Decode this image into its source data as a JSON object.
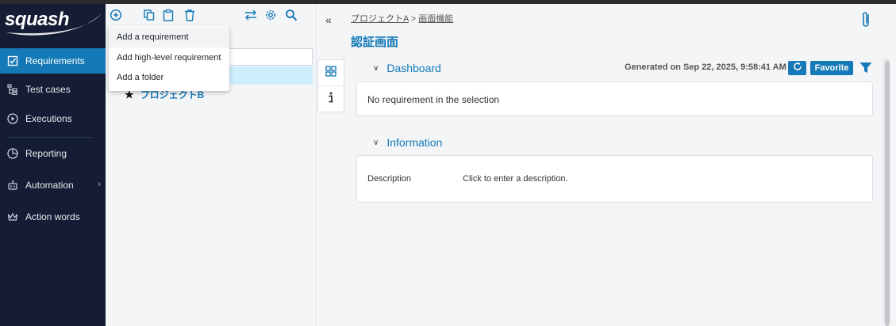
{
  "app": {
    "logo_text": "squash"
  },
  "sidebar": {
    "items": [
      {
        "label": "Requirements",
        "icon": "checkbox-icon",
        "active": true
      },
      {
        "label": "Test cases",
        "icon": "tree-icon"
      },
      {
        "label": "Executions",
        "icon": "play-circle-icon"
      },
      {
        "label": "Reporting",
        "icon": "pie-chart-icon"
      },
      {
        "label": "Automation",
        "icon": "robot-icon"
      },
      {
        "label": "Action words",
        "icon": "crown-icon"
      }
    ]
  },
  "tree": {
    "toolbar_icons": [
      "add-circle-icon",
      "copy-icon",
      "paste-icon",
      "trash-icon",
      "transfer-icon",
      "settings-icon",
      "search-icon"
    ],
    "rows": [
      {
        "label": "プロジェクトB",
        "favorite_icon": "star-icon"
      }
    ]
  },
  "add_menu": {
    "items": [
      "Add a requirement",
      "Add high-level requirement",
      "Add a folder"
    ]
  },
  "main": {
    "breadcrumb": {
      "project": "プロジェクトA",
      "separator": " > ",
      "folder": "画面機能"
    },
    "title": "認証画面",
    "dashboard": {
      "title": "Dashboard",
      "generated": "Generated on Sep 22, 2025, 9:58:41 AM",
      "favorite_label": "Favorite",
      "empty_message": "No requirement in the selection"
    },
    "information": {
      "title": "Information",
      "description_label": "Description",
      "description_placeholder": "Click to enter a description."
    }
  },
  "colors": {
    "accent": "#1479b6",
    "sidebar_bg": "#141d33",
    "selection": "#cfeefc"
  }
}
